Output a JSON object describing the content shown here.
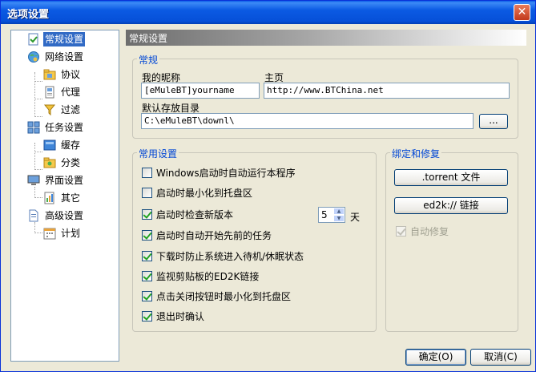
{
  "window": {
    "title": "选项设置",
    "close_glyph": "✕"
  },
  "tree": {
    "items": [
      {
        "label": "常规设置",
        "icon": "check-doc-icon",
        "selected": true
      },
      {
        "label": "网络设置",
        "icon": "network-icon"
      },
      {
        "label": "协议",
        "icon": "protocol-icon"
      },
      {
        "label": "代理",
        "icon": "proxy-icon"
      },
      {
        "label": "过滤",
        "icon": "filter-icon"
      },
      {
        "label": "任务设置",
        "icon": "task-icon"
      },
      {
        "label": "缓存",
        "icon": "cache-icon"
      },
      {
        "label": "分类",
        "icon": "category-icon"
      },
      {
        "label": "界面设置",
        "icon": "monitor-icon"
      },
      {
        "label": "其它",
        "icon": "other-icon"
      },
      {
        "label": "高级设置",
        "icon": "advanced-icon"
      },
      {
        "label": "计划",
        "icon": "schedule-icon"
      }
    ]
  },
  "content": {
    "header": "常规设置",
    "general": {
      "title": "常规",
      "nickname_label": "我的昵称",
      "nickname_value": "[eMuleBT]yourname",
      "homepage_label": "主页",
      "homepage_value": "http://www.BTChina.net",
      "dir_label": "默认存放目录",
      "dir_value": "C:\\eMuleBT\\downl\\",
      "browse_label": "..."
    },
    "common": {
      "title": "常用设置",
      "options": [
        {
          "label": "Windows启动时自动运行本程序",
          "checked": false
        },
        {
          "label": "启动时最小化到托盘区",
          "checked": false
        },
        {
          "label": "启动时检查新版本",
          "checked": true
        },
        {
          "label": "启动时自动开始先前的任务",
          "checked": true
        },
        {
          "label": "下载时防止系统进入待机/休眠状态",
          "checked": true
        },
        {
          "label": "监视剪贴板的ED2K链接",
          "checked": true
        },
        {
          "label": "点击关闭按钮时最小化到托盘区",
          "checked": true
        },
        {
          "label": "退出时确认",
          "checked": true
        }
      ],
      "days_value": "5",
      "days_unit": "天"
    },
    "bind": {
      "title": "绑定和修复",
      "torrent_button": ".torrent 文件",
      "ed2k_button": "ed2k:// 链接",
      "autofix_label": "自动修复",
      "autofix_checked": true
    }
  },
  "footer": {
    "ok_label": "确定(O)",
    "cancel_label": "取消(C)"
  },
  "colors": {
    "title_bar": "#0a5ce6",
    "selection": "#316ac5",
    "group_title": "#0046d5",
    "window_bg": "#ece9d8"
  }
}
